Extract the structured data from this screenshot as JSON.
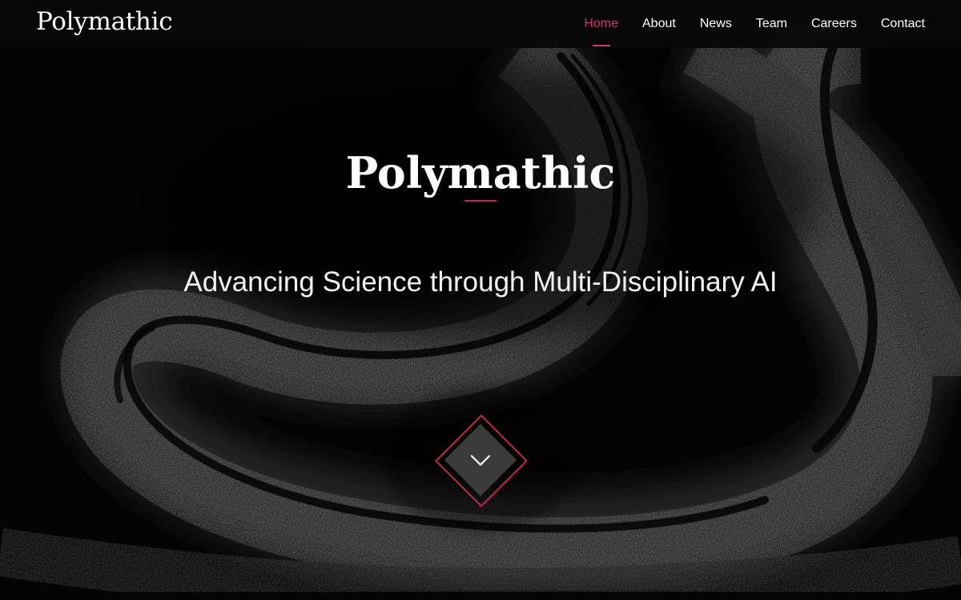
{
  "nav": {
    "brand": "Polymathic",
    "items": [
      {
        "label": "Home",
        "active": true
      },
      {
        "label": "About",
        "active": false
      },
      {
        "label": "News",
        "active": false
      },
      {
        "label": "Team",
        "active": false
      },
      {
        "label": "Careers",
        "active": false
      },
      {
        "label": "Contact",
        "active": false
      }
    ]
  },
  "hero": {
    "title": "Polymathic",
    "tagline": "Advancing Science through Multi-Disciplinary AI",
    "scroll_icon": "chevron-down-icon"
  },
  "colors": {
    "accent": "#d6336c",
    "background": "#000000",
    "button_fill": "#3b3b3b",
    "text": "#ffffff"
  }
}
